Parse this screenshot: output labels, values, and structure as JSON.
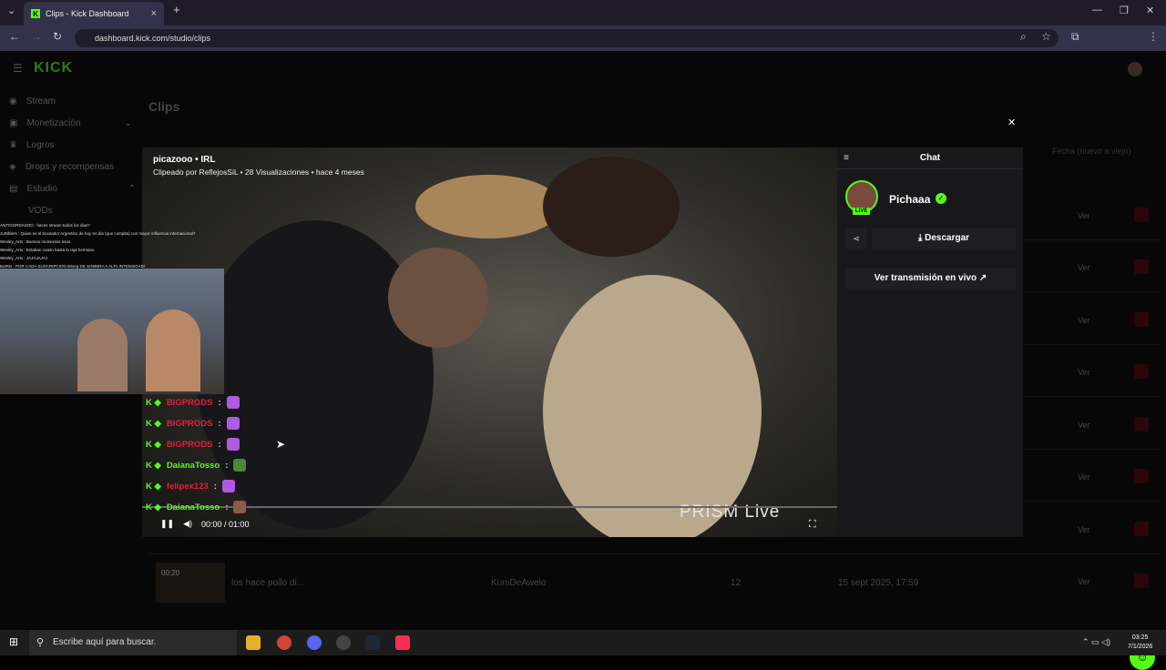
{
  "browser": {
    "tab_title": "Clips - Kick Dashboard",
    "tab_favicon": "K",
    "url": "dashboard.kick.com/studio/clips"
  },
  "sidebar": {
    "logo": "KICK",
    "items": [
      {
        "label": "Stream",
        "icon": "broadcast-icon"
      },
      {
        "label": "Monetización",
        "icon": "money-icon"
      },
      {
        "label": "Logros",
        "icon": "trophy-icon"
      },
      {
        "label": "Drops y recompensas",
        "icon": "gift-icon"
      },
      {
        "label": "Estudio",
        "icon": "studio-icon"
      },
      {
        "label": "VODs",
        "icon": ""
      }
    ]
  },
  "main": {
    "title": "Clips",
    "sort_label": "Fecha (nuevo a viejo)",
    "action_label": "Ver",
    "last_row": {
      "duration": "00:20",
      "title": "los hace pollo di...",
      "creator": "KumDeAwelo",
      "views": "12",
      "date": "15 sept 2025, 17:59"
    }
  },
  "modal": {
    "channel_category": "picazooo • IRL",
    "clip_info": "Clipeado por ReflejosSiL • 28 Visualizaciones • hace 4 meses",
    "watermark": "PRISM Live",
    "time": "00:00 / 01:00",
    "chat_title": "Chat",
    "streamer": "Pichaaa",
    "live_badge": "LIVE",
    "download_label": "Descargar",
    "live_link_label": "Ver transmisión en vivo"
  },
  "overlay": {
    "chat_lines": [
      "ANTIGORDASOO : haces stream todos los dias?",
      "JuRiblers : Quien es el boxeador Argentino de hoy en dia (que compita) con mayor influencia internacional?",
      "Wesley_Arts : Buenos momentos esos",
      "Wesley_Arts : Estaban cuasn hasta la raja hermano",
      "Wesley_Arts : JAJAJAJAJ",
      "BotRix : POR CADA SUSCRIPCION 80seg DE SOMBRA A ALTA INTENSIDAD!"
    ],
    "big_chat": [
      {
        "user": "BIGPRODS",
        "color": "#e0203a"
      },
      {
        "user": "BIGPRODS",
        "color": "#e0203a"
      },
      {
        "user": "BIGPRODS",
        "color": "#e0203a"
      },
      {
        "user": "DaianaTosso",
        "color": "#53fc18"
      },
      {
        "user": "felipex123",
        "color": "#e0203a"
      },
      {
        "user": "DaianaTosso",
        "color": "#53fc18"
      }
    ]
  },
  "taskbar": {
    "search_placeholder": "Escribe aquí para buscar.",
    "time": "03:25",
    "date": "7/1/2026"
  }
}
